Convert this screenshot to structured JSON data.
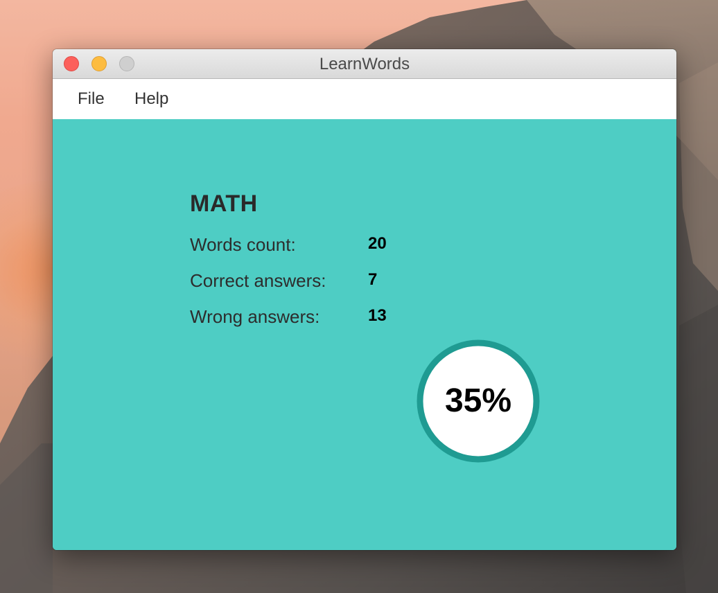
{
  "window": {
    "title": "LearnWords"
  },
  "menu": {
    "items": [
      {
        "label": "File"
      },
      {
        "label": "Help"
      }
    ]
  },
  "quiz": {
    "subject": "MATH",
    "stats": [
      {
        "label": "Words count:",
        "value": "20"
      },
      {
        "label": "Correct answers:",
        "value": "7"
      },
      {
        "label": "Wrong answers:",
        "value": "13"
      }
    ],
    "score_text": "35%",
    "score_fraction": 0.35
  },
  "colors": {
    "content_bg": "#4ecdc4",
    "ring": "#1f9b92",
    "close": "#fc605b",
    "minimize": "#fdbc40",
    "zoom": "#cfcfcf"
  },
  "icons": {
    "close": "close-traffic-light-icon",
    "minimize": "minimize-traffic-light-icon",
    "zoom": "zoom-traffic-light-icon"
  }
}
